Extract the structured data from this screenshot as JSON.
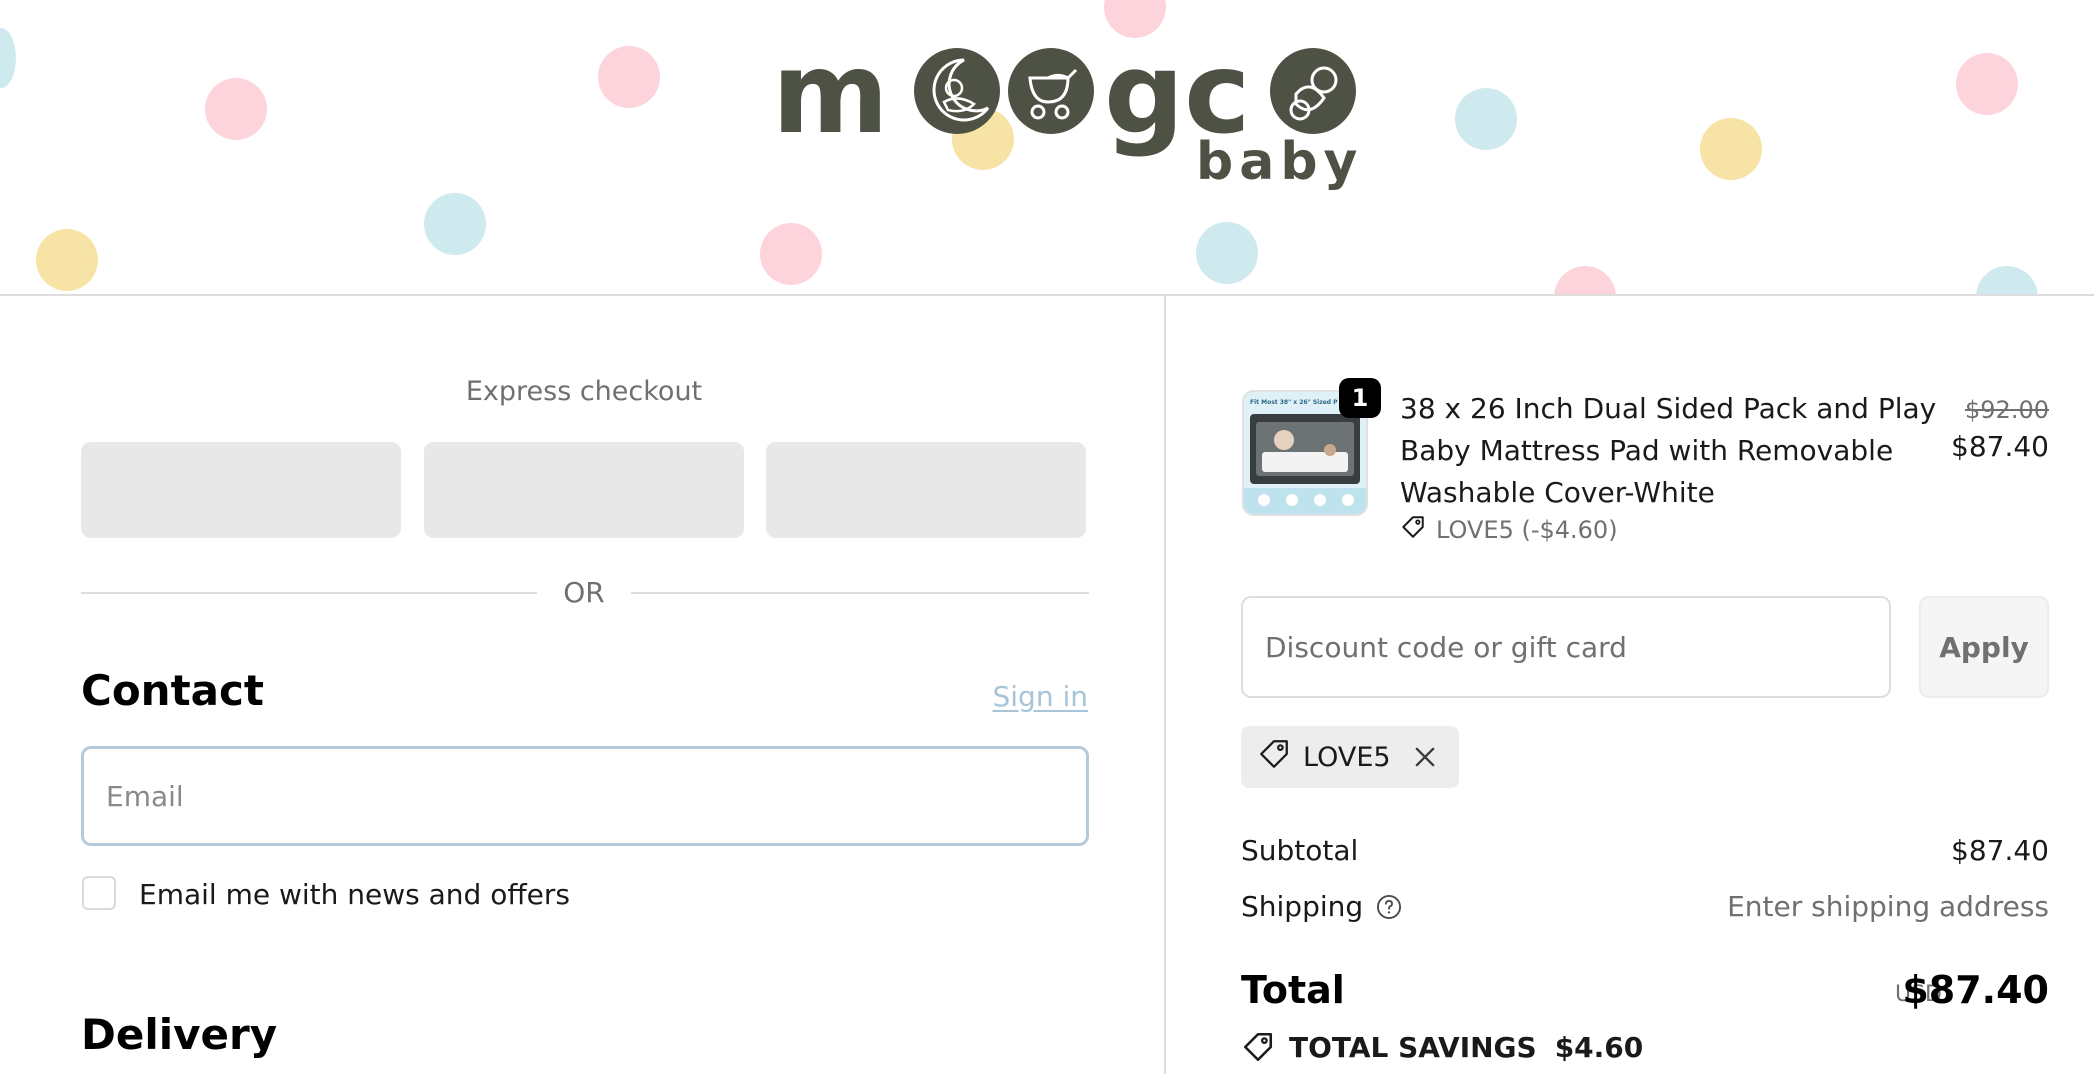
{
  "brand": {
    "logo_text": "moogco",
    "logo_subtext": "baby",
    "logo_color": "#4e5245"
  },
  "express": {
    "title": "Express checkout",
    "divider_text": "OR"
  },
  "contact": {
    "title": "Contact",
    "sign_in": "Sign in",
    "email_placeholder": "Email",
    "newsletter_label": "Email me with news and offers"
  },
  "delivery": {
    "title": "Delivery"
  },
  "cart": {
    "item": {
      "quantity": "1",
      "title": "38 x 26 Inch Dual Sided Pack and Play Baby Mattress Pad with Removable Washable Cover-White",
      "discount": "LOVE5 (-$4.60)",
      "original_price": "$92.00",
      "price": "$87.40",
      "thumbnail_caption": "Fit Most 38\" x 26\" Sized P"
    },
    "discount_placeholder": "Discount code or gift card",
    "apply_label": "Apply",
    "applied_code": "LOVE5"
  },
  "summary": {
    "subtotal_label": "Subtotal",
    "subtotal_value": "$87.40",
    "shipping_label": "Shipping",
    "shipping_value": "Enter shipping address",
    "total_label": "Total",
    "total_currency": "USD",
    "total_value": "$87.40",
    "savings_label": "TOTAL SAVINGS",
    "savings_value": "$4.60"
  },
  "icons": {
    "tag": "tag-icon",
    "close": "close-icon",
    "help": "question-circle-icon",
    "moon": "moon-baby-icon",
    "stroller": "stroller-icon",
    "pacifier": "pacifier-icon"
  },
  "colors": {
    "accent_link": "#a7c4d9",
    "focus_border": "#b4cbdb",
    "badge_bg": "#000000"
  }
}
